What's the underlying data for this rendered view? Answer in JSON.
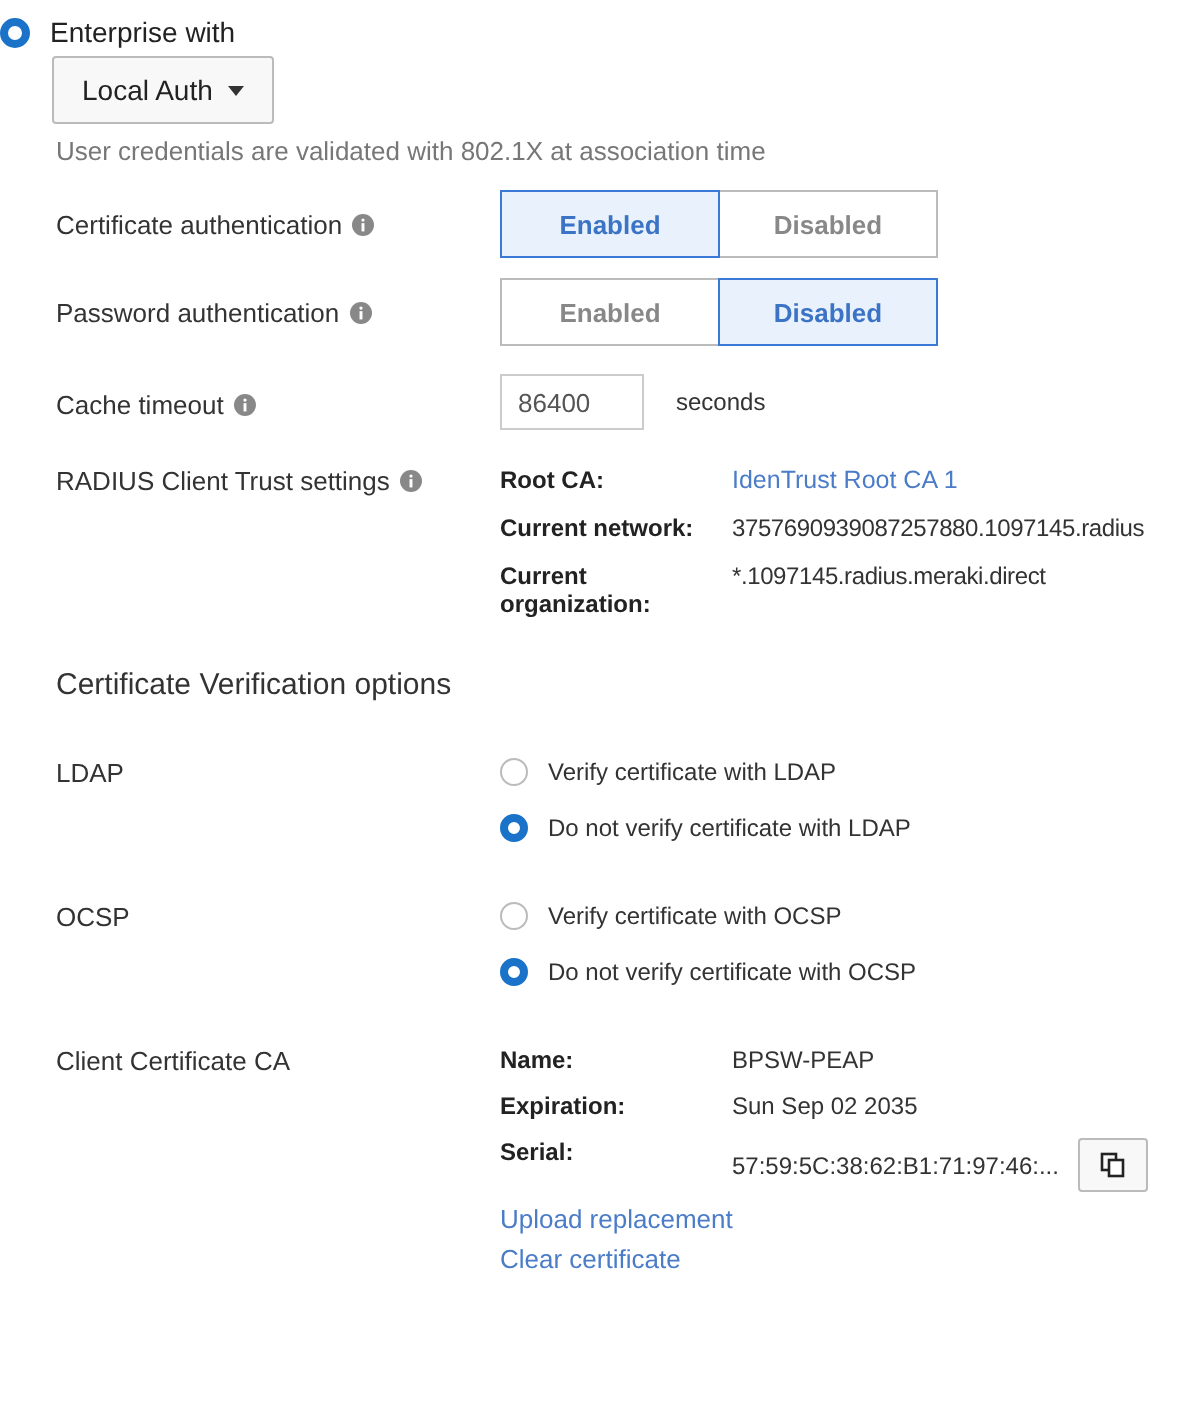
{
  "mode": {
    "label": "Enterprise with",
    "selected": true
  },
  "auth_dropdown": {
    "value": "Local Auth"
  },
  "hint": "User credentials are validated with 802.1X at association time",
  "toggles": [
    {
      "label": "Certificate authentication",
      "options": [
        {
          "label": "Enabled",
          "selected": true
        },
        {
          "label": "Disabled",
          "selected": false
        }
      ]
    },
    {
      "label": "Password authentication",
      "options": [
        {
          "label": "Enabled",
          "selected": false
        },
        {
          "label": "Disabled",
          "selected": true
        }
      ]
    }
  ],
  "cache_timeout": {
    "label": "Cache timeout",
    "value": "86400",
    "unit": "seconds"
  },
  "trust": {
    "label": "RADIUS Client Trust settings",
    "items": [
      {
        "key": "Root CA:",
        "value": "IdenTrust Root CA 1",
        "kind": "link"
      },
      {
        "key": "Current network:",
        "value": "3757690939087257880.1097145.radius",
        "kind": "text"
      },
      {
        "key": "Current organization:",
        "value": "*.1097145.radius.meraki.direct",
        "kind": "text"
      }
    ]
  },
  "verification": {
    "heading": "Certificate Verification options",
    "groups": [
      {
        "label": "LDAP",
        "options": [
          {
            "label": "Verify certificate with LDAP",
            "selected": false
          },
          {
            "label": "Do not verify certificate with LDAP",
            "selected": true
          }
        ]
      },
      {
        "label": "OCSP",
        "options": [
          {
            "label": "Verify certificate with OCSP",
            "selected": false
          },
          {
            "label": "Do not verify certificate with OCSP",
            "selected": true
          }
        ]
      }
    ]
  },
  "client_ca": {
    "label": "Client Certificate CA",
    "fields": [
      {
        "key": "Name:",
        "value": "BPSW-PEAP",
        "kind": "text"
      },
      {
        "key": "Expiration:",
        "value": "Sun Sep 02 2035",
        "kind": "text"
      },
      {
        "key": "Serial:",
        "value": "57:59:5C:38:62:B1:71:97:46:...",
        "kind": "copy"
      }
    ],
    "links": [
      "Upload replacement",
      "Clear certificate"
    ]
  }
}
